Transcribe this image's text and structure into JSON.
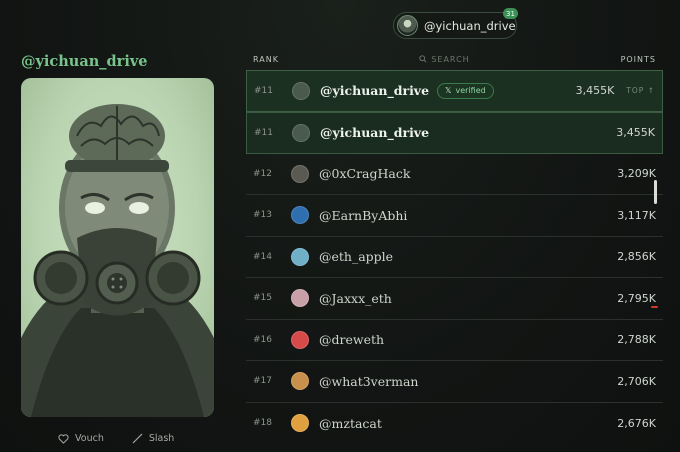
{
  "header": {
    "user": "@yichuan_drive",
    "badge": "31"
  },
  "profile": {
    "handle": "@yichuan_drive",
    "actions": [
      {
        "label": "Vouch",
        "icon": "heart-icon"
      },
      {
        "label": "Slash",
        "icon": "slash-icon"
      }
    ]
  },
  "table": {
    "headers": {
      "rank": "RANK",
      "search": "SEARCH",
      "points": "POINTS"
    },
    "pinned": {
      "rank": "#11",
      "name": "@yichuan_drive",
      "verified_label": "verified",
      "points": "3,455K",
      "top_label": "TOP ↑"
    },
    "rows": [
      {
        "rank": "#11",
        "name": "@yichuan_drive",
        "points": "3,455K",
        "avatar_color": "#4a5a4c"
      },
      {
        "rank": "#12",
        "name": "@0xCragHack",
        "points": "3,209K",
        "avatar_color": "#5a5a52"
      },
      {
        "rank": "#13",
        "name": "@EarnByAbhi",
        "points": "3,117K",
        "avatar_color": "#2f6fb0"
      },
      {
        "rank": "#14",
        "name": "@eth_apple",
        "points": "2,856K",
        "avatar_color": "#6fb0c8"
      },
      {
        "rank": "#15",
        "name": "@Jaxxx_eth",
        "points": "2,795K",
        "avatar_color": "#c9a0a8"
      },
      {
        "rank": "#16",
        "name": "@dreweth",
        "points": "2,788K",
        "avatar_color": "#d84a4a"
      },
      {
        "rank": "#17",
        "name": "@what3verman",
        "points": "2,706K",
        "avatar_color": "#c8904a"
      },
      {
        "rank": "#18",
        "name": "@mztacat",
        "points": "2,676K",
        "avatar_color": "#e0a040"
      }
    ]
  }
}
